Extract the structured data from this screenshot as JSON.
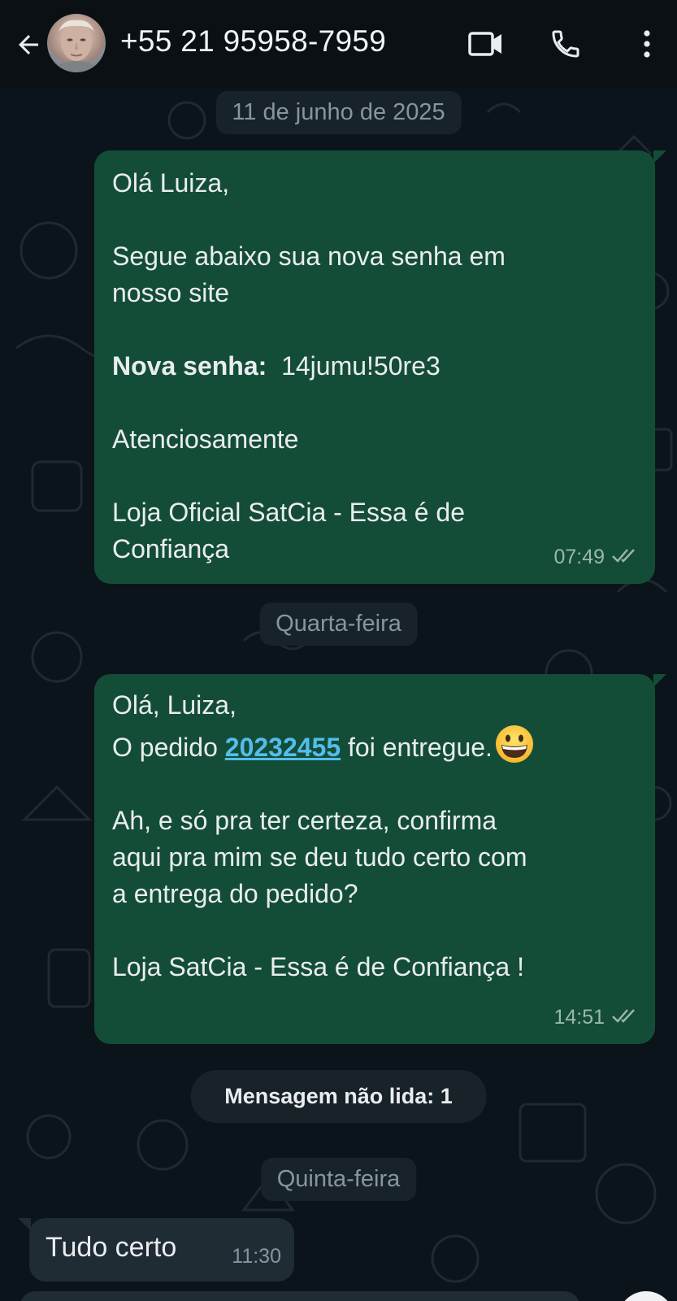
{
  "header": {
    "contact_name": "+55 21 95958-7959"
  },
  "chips": {
    "date_1": "11 de junho de 2025",
    "date_2": "Quarta-feira",
    "unread": "Mensagem não lida: 1",
    "date_3": "Quinta-feira"
  },
  "message_1": {
    "greeting": "Olá Luiza,",
    "line_1": "Segue abaixo sua nova senha em",
    "line_2": "nosso site",
    "password_label": "Nova senha:",
    "password_value": "14jumu!50re3",
    "closing": "Atenciosamente",
    "signature_1": "Loja Oficial SatCia - Essa é de",
    "signature_2": "Confiança",
    "time": "07:49"
  },
  "message_2": {
    "greeting": "Olá, Luiza,",
    "order_prefix": "O pedido ",
    "order_number": "20232455",
    "order_suffix": " foi entregue.",
    "emoji": "grinning-face",
    "line_1": "Ah, e só pra ter certeza, confirma",
    "line_2": "aqui pra mim se deu tudo certo com",
    "line_3": "a entrega do pedido?",
    "signature": "Loja SatCia - Essa é de Confiança !",
    "time": "14:51"
  },
  "message_3": {
    "text": "Tudo certo",
    "time": "11:30"
  },
  "colors": {
    "header_bg": "#0b1014",
    "chat_bg": "#0b141a",
    "outgoing_bubble": "#144d37",
    "incoming_bubble": "#1f2c34",
    "link": "#53bdeb",
    "read_ticks": "#9bb8aa"
  }
}
